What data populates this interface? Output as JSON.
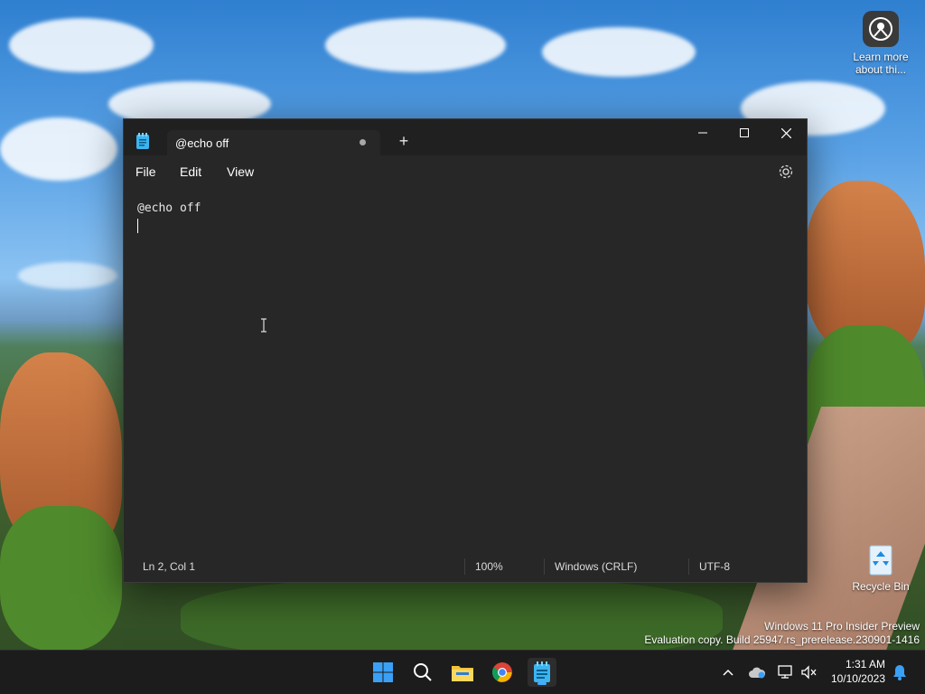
{
  "desktop": {
    "learn_more_label": "Learn more about thi...",
    "recycle_bin_label": "Recycle Bin",
    "watermark_line1": "Windows 11 Pro Insider Preview",
    "watermark_line2": "Evaluation copy. Build 25947.rs_prerelease.230901-1416"
  },
  "window": {
    "tab_title": "@echo off",
    "new_tab_label": "+",
    "menu": [
      "File",
      "Edit",
      "View"
    ],
    "content_lines": [
      "@echo off",
      ""
    ],
    "status": {
      "position": "Ln 2, Col 1",
      "zoom": "100%",
      "line_ending": "Windows (CRLF)",
      "encoding": "UTF-8"
    }
  },
  "taskbar": {
    "time": "1:31 AM",
    "date": "10/10/2023"
  },
  "colors": {
    "accent": "#4aa8ff",
    "window_bg": "#272727",
    "titlebar_bg": "#202020",
    "taskbar_bg": "#1c1c1c"
  }
}
